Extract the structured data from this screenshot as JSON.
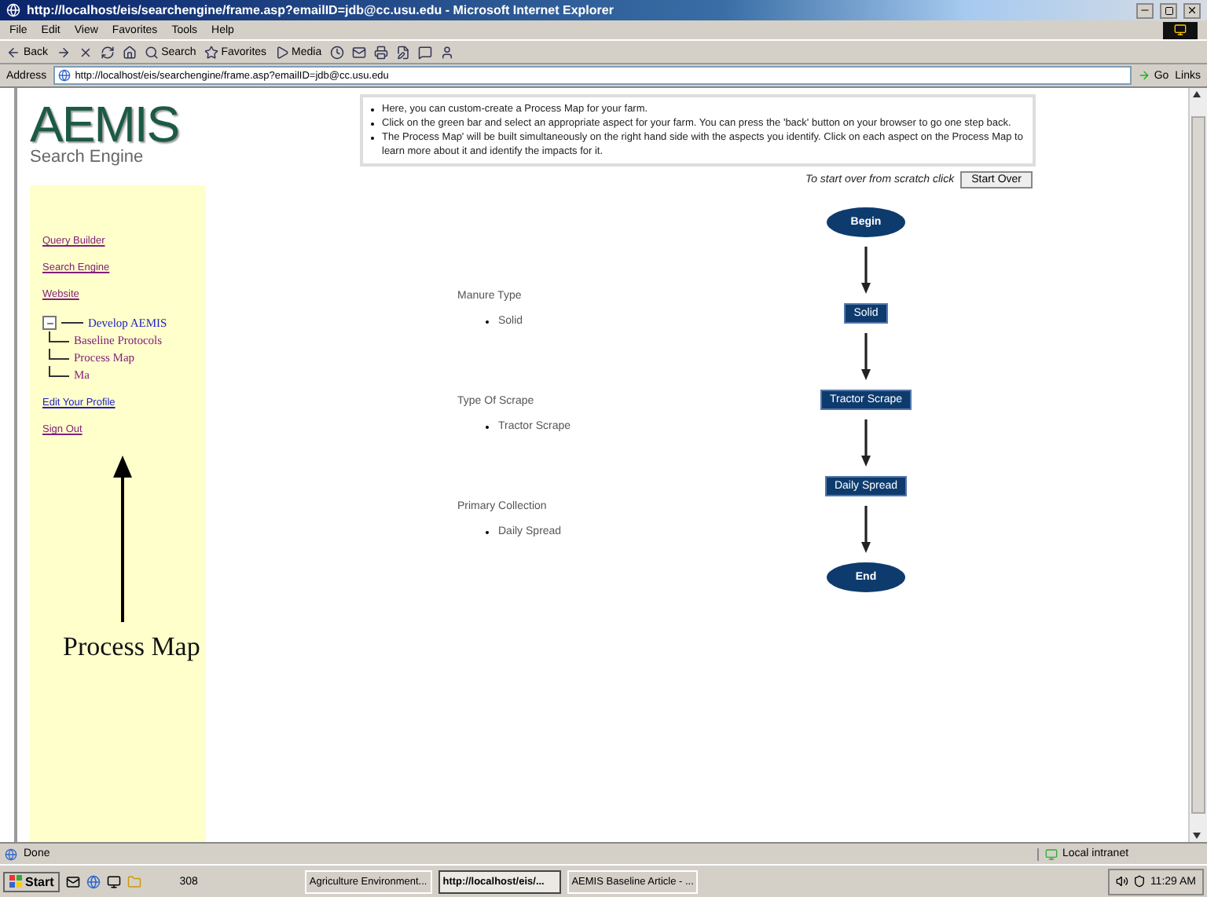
{
  "window": {
    "title": "http://localhost/eis/searchengine/frame.asp?emailID=jdb@cc.usu.edu - Microsoft Internet Explorer"
  },
  "menu": [
    "File",
    "Edit",
    "View",
    "Favorites",
    "Tools",
    "Help"
  ],
  "toolbar": [
    {
      "kind": "back",
      "label": "Back"
    },
    {
      "kind": "forward"
    },
    {
      "kind": "stop"
    },
    {
      "kind": "refresh"
    },
    {
      "kind": "home"
    },
    {
      "kind": "search",
      "label": "Search"
    },
    {
      "kind": "favorites",
      "label": "Favorites"
    },
    {
      "kind": "media",
      "label": "Media"
    },
    {
      "kind": "history"
    },
    {
      "kind": "mail"
    },
    {
      "kind": "print"
    },
    {
      "kind": "edit"
    },
    {
      "kind": "discuss"
    },
    {
      "kind": "messenger"
    }
  ],
  "address_bar": {
    "label": "Address",
    "value": "http://localhost/eis/searchengine/frame.asp?emailID=jdb@cc.usu.edu",
    "go": "Go",
    "links": "Links"
  },
  "logo": {
    "title": "AEMIS",
    "subtitle": "Search Engine"
  },
  "sidebar": {
    "links": [
      {
        "label": "Query Builder",
        "visited": true
      },
      {
        "label": "Search Engine",
        "visited": true
      },
      {
        "label": "Website",
        "visited": true
      }
    ],
    "tree": {
      "label": "Develop AEMIS",
      "expanded": true,
      "children": [
        {
          "label": "Baseline Protocols"
        },
        {
          "label": "Process Map"
        },
        {
          "label": "Ma"
        }
      ]
    },
    "links_after": [
      {
        "label": "Edit Your Profile",
        "visited": false
      },
      {
        "label": "Sign Out",
        "visited": true
      }
    ]
  },
  "instructions": [
    "Here, you can custom-create a Process Map for your farm.",
    "Click on the green bar and select an appropriate aspect for your farm. You can press the 'back' button on your browser to go one step back.",
    "The Process Map' will be built simultaneously on the right hand side with the aspects you identify. Click on each aspect on the Process Map to learn more about it and identify the impacts for it."
  ],
  "start_over": {
    "prompt": "To start over from scratch click",
    "button": "Start Over"
  },
  "aspects": [
    {
      "title": "Manure Type",
      "value": "Solid"
    },
    {
      "title": "Type Of Scrape",
      "value": "Tractor Scrape"
    },
    {
      "title": "Primary Collection",
      "value": "Daily Spread"
    }
  ],
  "process_map": [
    {
      "kind": "terminal",
      "label": "Begin"
    },
    {
      "kind": "step",
      "label": "Solid"
    },
    {
      "kind": "step",
      "label": "Tractor Scrape"
    },
    {
      "kind": "step",
      "label": "Daily Spread"
    },
    {
      "kind": "terminal",
      "label": "End"
    }
  ],
  "annotation": {
    "label": "Process Map"
  },
  "status_bar": {
    "text": "Done",
    "zone": "Local intranet"
  },
  "taskbar": {
    "start": "Start",
    "toolbar_label": "308",
    "tasks": [
      {
        "label": "Agriculture Environment...",
        "selected": false
      },
      {
        "label": "http://localhost/eis/...",
        "selected": true
      },
      {
        "label": "AEMIS Baseline Article - ...",
        "selected": false
      }
    ],
    "clock": "11:29 AM"
  }
}
